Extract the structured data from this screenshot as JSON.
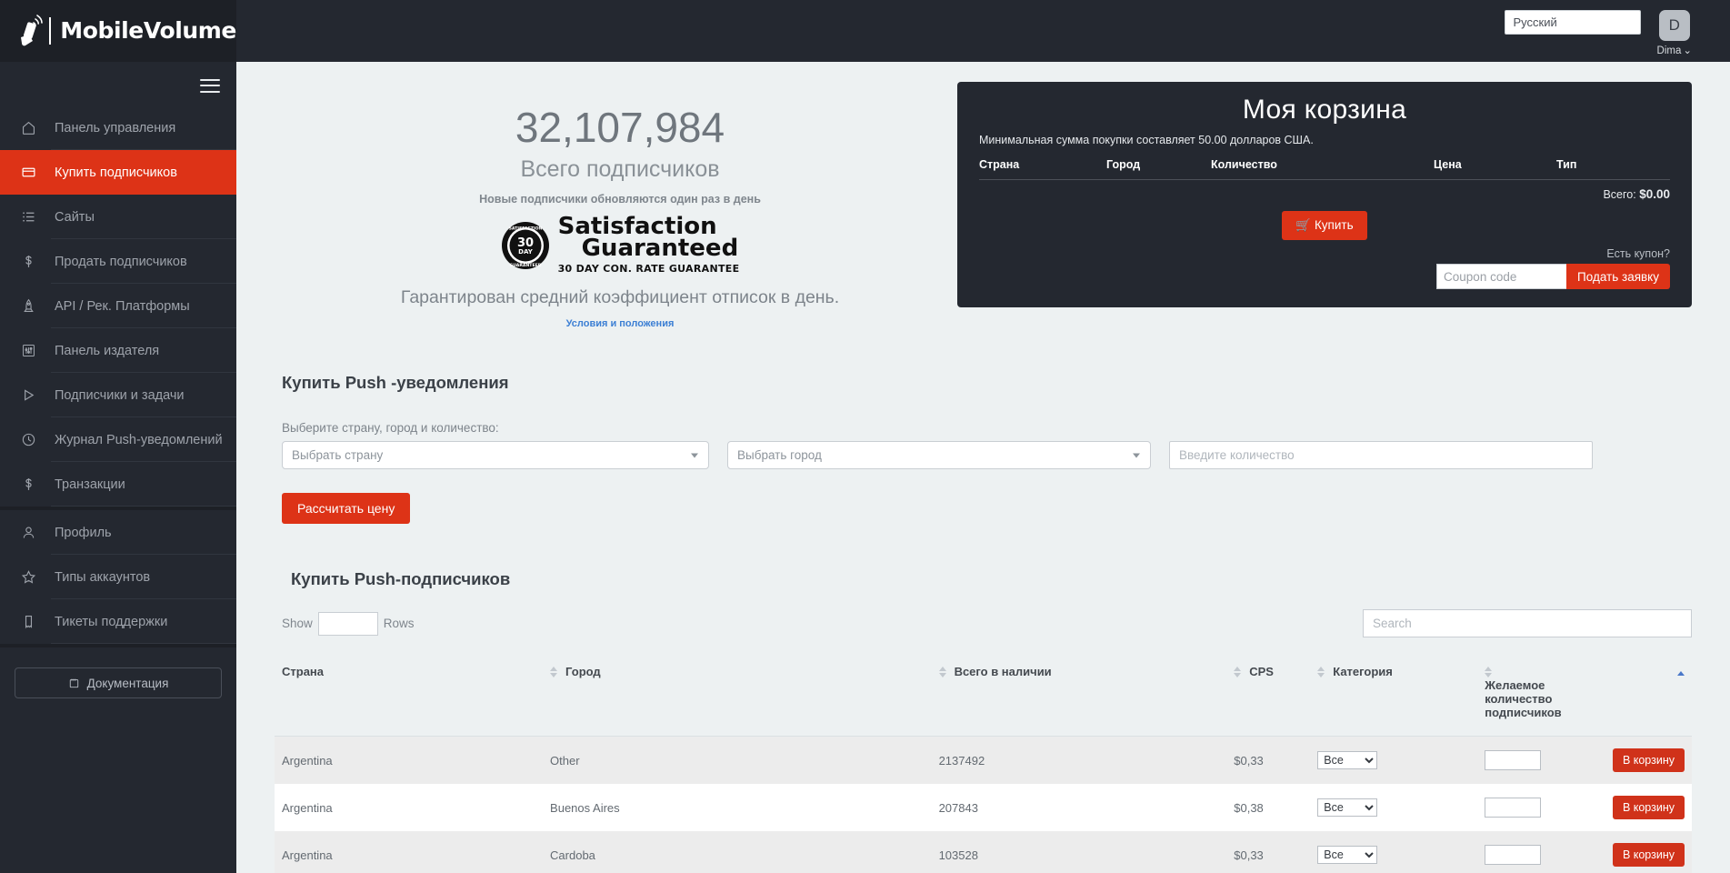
{
  "brand": {
    "name": "MobileVolume",
    "logo_icon": "megaphone-hand-icon"
  },
  "sidebar": {
    "hamburger_icon": "hamburger-menu-icon",
    "groups": [
      {
        "items": [
          {
            "label": "Панель управления",
            "icon": "home-icon",
            "active": false
          },
          {
            "label": "Купить подписчиков",
            "icon": "credit-card-icon",
            "active": true
          },
          {
            "label": "Сайты",
            "icon": "list-icon",
            "active": false
          },
          {
            "label": "Продать подписчиков",
            "icon": "dollar-icon",
            "active": false
          },
          {
            "label": "API / Рек. Платформы",
            "icon": "rocket-icon",
            "active": false
          },
          {
            "label": "Панель издателя",
            "icon": "sliders-icon",
            "active": false
          },
          {
            "label": "Подписчики и задачи",
            "icon": "play-icon",
            "active": false
          },
          {
            "label": "Журнал Push-уведомлений",
            "icon": "clock-icon",
            "active": false
          },
          {
            "label": "Транзакции",
            "icon": "dollar-icon",
            "active": false
          }
        ]
      },
      {
        "items": [
          {
            "label": "Профиль",
            "icon": "user-icon",
            "active": false
          },
          {
            "label": "Типы аккаунтов",
            "icon": "star-icon",
            "active": false
          },
          {
            "label": "Тикеты поддержки",
            "icon": "ticket-icon",
            "active": false
          }
        ]
      }
    ],
    "documentation_label": "Документация",
    "documentation_icon": "book-icon"
  },
  "topbar": {
    "language": "Русский",
    "avatar_initial": "D",
    "username": "Dima",
    "caret_icon": "chevron-down-icon"
  },
  "hero": {
    "count": "32,107,984",
    "count_label": "Всего подписчиков",
    "note": "Новые подписчики обновляются один раз в день",
    "seal_icon": "satisfaction-guaranteed-seal-icon",
    "seal_line1": "Satisfaction",
    "seal_line2": "Guaranteed",
    "seal_line3": "30 DAY CON. RATE  GUARANTEE",
    "guarantee": "Гарантирован средний коэффициент отписок в день.",
    "terms_link": "Условия и положения"
  },
  "cart": {
    "title": "Моя корзина",
    "min_purchase": "Минимальная сумма покупки составляет 50.00 долларов США.",
    "columns": [
      "Страна",
      "Город",
      "Количество",
      "Цена",
      "Тип"
    ],
    "rows": [],
    "total_label": "Всего:",
    "total_value": "$0.00",
    "buy_label": "Купить",
    "buy_icon": "shopping-cart-icon",
    "coupon_label": "Есть купон?",
    "coupon_placeholder": "Coupon code",
    "coupon_value": "",
    "coupon_button": "Подать заявку"
  },
  "buy_form": {
    "title": "Купить Push -уведомления",
    "label": "Выберите страну, город и количество:",
    "country_placeholder": "Выбрать страну",
    "city_placeholder": "Выбрать город",
    "quantity_placeholder": "Введите количество",
    "quantity_value": "",
    "calculate_button": "Рассчитать цену",
    "dropdown_icon": "chevron-down-icon"
  },
  "table_section": {
    "title": "Купить Push-подписчиков",
    "show_label": "Show",
    "rows_label": "Rows",
    "show_value": "",
    "search_placeholder": "Search",
    "search_value": "",
    "columns": [
      {
        "label": "Страна",
        "sortable": false,
        "sorted": null
      },
      {
        "label": "Город",
        "sortable": true,
        "sorted": null
      },
      {
        "label": "Всего в наличии",
        "sortable": true,
        "sorted": null
      },
      {
        "label": "CPS",
        "sortable": true,
        "sorted": null
      },
      {
        "label": "Категория",
        "sortable": true,
        "sorted": null
      },
      {
        "label": "Желаемое количество подписчиков",
        "sortable": true,
        "sorted": "asc"
      }
    ],
    "category_options": [
      "Все"
    ],
    "add_to_cart_label": "В корзину",
    "rows": [
      {
        "country": "Argentina",
        "city": "Other",
        "available": "2137492",
        "cps": "$0,33",
        "category": "Все",
        "want": ""
      },
      {
        "country": "Argentina",
        "city": "Buenos Aires",
        "available": "207843",
        "cps": "$0,38",
        "category": "Все",
        "want": ""
      },
      {
        "country": "Argentina",
        "city": "Cardoba",
        "available": "103528",
        "cps": "$0,33",
        "category": "Все",
        "want": ""
      }
    ]
  },
  "colors": {
    "accent": "#dd3317",
    "sidebar_bg": "#242830",
    "page_bg": "#edf1f2",
    "link": "#3c7fd4"
  }
}
